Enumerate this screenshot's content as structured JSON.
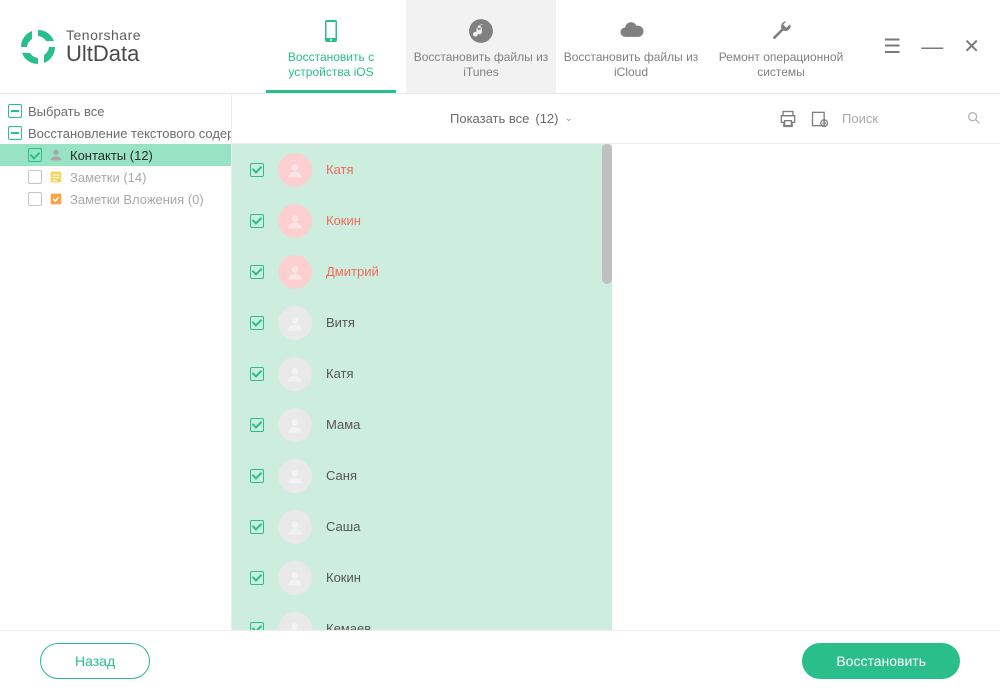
{
  "app": {
    "brand_top": "Tenorshare",
    "brand_main": "UltData"
  },
  "tabs": [
    {
      "label": "Восстановить с устройства iOS"
    },
    {
      "label": "Восстановить файлы из iTunes"
    },
    {
      "label": "Восстановить файлы из iCloud"
    },
    {
      "label": "Ремонт операционной системы"
    }
  ],
  "sidebar": {
    "select_all": "Выбрать все",
    "group_label": "Восстановление текстового содержимо",
    "items": [
      {
        "label": "Контакты (12)",
        "checked": true,
        "active": true,
        "icon": "contacts"
      },
      {
        "label": "Заметки (14)",
        "checked": false,
        "active": false,
        "icon": "notes"
      },
      {
        "label": "Заметки Вложения (0)",
        "checked": false,
        "active": false,
        "icon": "attach"
      }
    ]
  },
  "toolbar": {
    "filter_label": "Показать все",
    "filter_count": "(12)",
    "search_placeholder": "Поиск"
  },
  "contacts": [
    {
      "name": "Катя",
      "deleted": true
    },
    {
      "name": "Кокин",
      "deleted": true
    },
    {
      "name": "Дмитрий",
      "deleted": true
    },
    {
      "name": "Витя",
      "deleted": false
    },
    {
      "name": "Катя",
      "deleted": false
    },
    {
      "name": "Мама",
      "deleted": false
    },
    {
      "name": "Саня",
      "deleted": false
    },
    {
      "name": "Саша",
      "deleted": false
    },
    {
      "name": "Кокин",
      "deleted": false
    },
    {
      "name": "Кемаев",
      "deleted": false
    }
  ],
  "footer": {
    "back": "Назад",
    "recover": "Восстановить"
  }
}
